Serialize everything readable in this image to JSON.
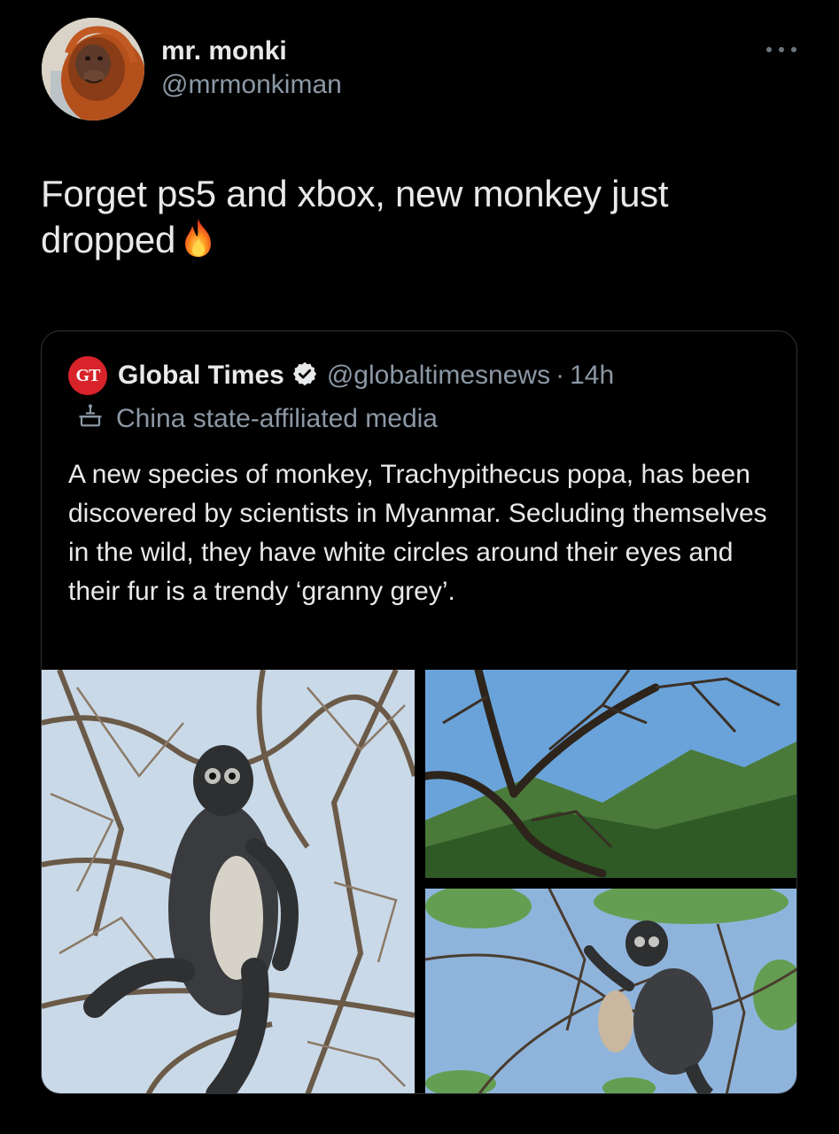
{
  "author": {
    "display_name": "mr. monki",
    "handle": "@mrmonkiman"
  },
  "tweet": {
    "text": "Forget ps5 and xbox, new monkey just dropped",
    "emoji": "fire-emoji"
  },
  "quoted_tweet": {
    "logo_text": "GT",
    "display_name": "Global Times",
    "handle": "@globaltimesnews",
    "separator": "·",
    "time": "14h",
    "label": "China state-affiliated media",
    "text": "A new species of monkey, Trachypithecus popa, has been discovered by scientists in Myanmar. Secluding themselves in the wild, they have white circles around their eyes and their fur is a trendy ‘granny grey’.",
    "media": [
      {
        "desc_icon": "monkey-in-tree-photo"
      },
      {
        "desc_icon": "forest-mountains-photo"
      },
      {
        "desc_icon": "monkey-with-baby-photo"
      }
    ]
  },
  "colors": {
    "background": "#000000",
    "text_primary": "#e7e9ea",
    "text_secondary": "#8b98a5",
    "border": "#2f3336",
    "brand_red": "#d8232a",
    "verified_badge": "#e7e9ea"
  },
  "icons": {
    "more": "more-horizontal-icon",
    "verified": "verified-badge-icon",
    "state_media": "state-media-podium-icon"
  }
}
